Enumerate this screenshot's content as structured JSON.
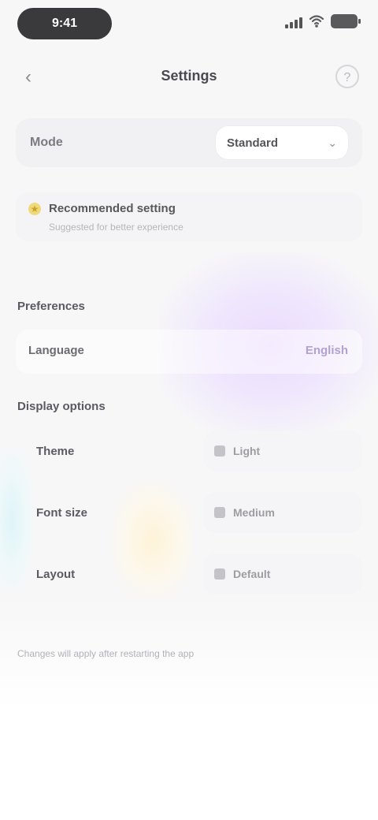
{
  "status_bar": {
    "time": "9:41"
  },
  "header": {
    "back_icon": "‹",
    "title": "Settings",
    "help_icon": "?"
  },
  "mode_card": {
    "label": "Mode",
    "selected": "Standard"
  },
  "notice": {
    "title": "Recommended setting",
    "subtitle": "Suggested for better experience"
  },
  "section_1": {
    "title": "Preferences",
    "row_label": "Language",
    "row_value": "English"
  },
  "section_2": {
    "title": "Display options",
    "items": [
      {
        "label": "Theme",
        "value": "Light"
      },
      {
        "label": "Font size",
        "value": "Medium"
      },
      {
        "label": "Layout",
        "value": "Default"
      }
    ]
  },
  "footer": {
    "note": "Changes will apply after restarting the app"
  },
  "colors": {
    "accent_purple": "#b3a1d2",
    "accent_yellow": "#f0d97a"
  }
}
